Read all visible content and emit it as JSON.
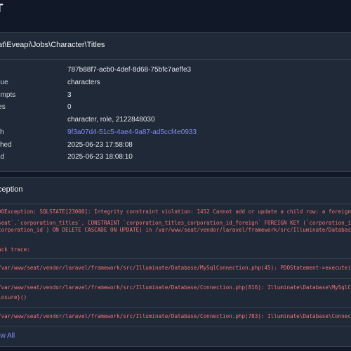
{
  "page": {
    "title": "T"
  },
  "job": {
    "class_name": "at\\Eveapi\\Jobs\\Character\\Titles",
    "rows": [
      {
        "label": "",
        "value": "787b88f7-acb0-4def-8d68-75bfc7aeffe3"
      },
      {
        "label": "eue",
        "value": "characters"
      },
      {
        "label": "empts",
        "value": "3"
      },
      {
        "label": "ies",
        "value": "0"
      },
      {
        "label": "s",
        "value": "character, role, 2122848030"
      },
      {
        "label": "ch",
        "value": "9f3a07d4-51c5-4ae4-9a87-ad5ccf4e0933"
      },
      {
        "label": "shed",
        "value": "2025-06-23 17:58:08"
      },
      {
        "label": "ed",
        "value": "2025-06-23 18:08:10"
      }
    ]
  },
  "exception": {
    "header": "ception",
    "message_lines": [
      "DOException: SQLSTATE[23000]: Integrity constraint violation: 1452 Cannot add or update a child row: a foreign key cons",
      "seat`.`corporation_titles`, CONSTRAINT `corporation_titles_corporation_id_foreign` FOREIGN KEY (`corporation_id`) REFE",
      "corporation_id`) ON DELETE CASCADE ON UPDATE) in /var/www/seat/vendor/laravel/framework/src/Illuminate/Database/MySqlC"
    ],
    "stack_title": "ack trace:",
    "frames": [
      [
        "/var/www/seat/vendor/laravel/framework/src/Illuminate/Database/MySqlConnection.php(45): PDOStatement->execute()"
      ],
      [
        "/var/www/seat/vendor/laravel/framework/src/Illuminate/Database/Connection.php(816): Illuminate\\Database\\MySqlConnecti",
        "losure}()"
      ],
      [
        "/var/www/seat/vendor/laravel/framework/src/Illuminate/Database/Connection.php(783): Illuminate\\Database\\Connection->"
      ]
    ],
    "show_all": "ow All"
  },
  "colors": {
    "background": "#111827",
    "card": "#1f2937",
    "link": "#818cf8",
    "error": "#f87171"
  }
}
